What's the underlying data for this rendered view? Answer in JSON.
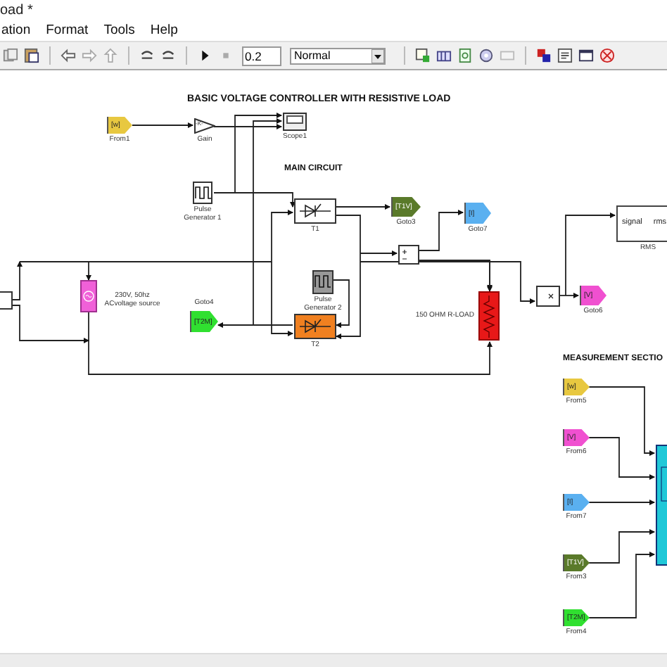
{
  "window": {
    "title": "oad *"
  },
  "menu": [
    "ation",
    "Format",
    "Tools",
    "Help"
  ],
  "toolbar": {
    "stop_time": "0.2",
    "mode": "Normal"
  },
  "diagram": {
    "headings": [
      {
        "kind": "title",
        "text": "BASIC VOLTAGE CONTROLLER WITH RESISTIVE LOAD"
      },
      {
        "kind": "section",
        "text": "MAIN CIRCUIT"
      },
      {
        "kind": "section",
        "text": "MEASUREMENT SECTIO"
      }
    ],
    "blocks": [
      {
        "kind": "tag",
        "text": "[w]",
        "label": "From1",
        "color": "#e8c840"
      },
      {
        "kind": "gain",
        "text": "-K-",
        "label": "Gain"
      },
      {
        "kind": "scope",
        "label": "Scope1"
      },
      {
        "kind": "pulse",
        "label": "Pulse Generator 1"
      },
      {
        "kind": "thyristor",
        "label": "T1",
        "color": "#ffffff"
      },
      {
        "kind": "tag",
        "text": "[T1V]",
        "label": "Goto3",
        "color": "#5a7a2a"
      },
      {
        "kind": "tag",
        "text": "[I]",
        "label": "Goto7",
        "color": "#5ab0f0"
      },
      {
        "kind": "rms",
        "text": "signal",
        "text_2": "rms",
        "label": "RMS"
      },
      {
        "kind": "sum"
      },
      {
        "kind": "terminal"
      },
      {
        "kind": "source",
        "label": "230V, 50hz ACvoltage source"
      },
      {
        "kind": "tag",
        "text": "[T2M]",
        "label": "Goto4",
        "color": "#30e030"
      },
      {
        "kind": "pulse",
        "label": "Pulse Generator 2"
      },
      {
        "kind": "thyristor",
        "label": "T2",
        "color": "#f08020"
      },
      {
        "kind": "resistor",
        "label": "150 OHM R-LOAD"
      },
      {
        "kind": "product"
      },
      {
        "kind": "tag",
        "text": "[V]",
        "label": "Goto6",
        "color": "#f050d0"
      },
      {
        "kind": "tag",
        "text": "[w]",
        "label": "From5",
        "color": "#e8c840"
      },
      {
        "kind": "tag",
        "text": "[V]",
        "label": "From6",
        "color": "#f050d0"
      },
      {
        "kind": "tag",
        "text": "[I]",
        "label": "From7",
        "color": "#5ab0f0"
      },
      {
        "kind": "tag",
        "text": "[T1V]",
        "label": "From3",
        "color": "#5a7a2a"
      },
      {
        "kind": "tag",
        "text": "[T2M]",
        "label": "From4",
        "color": "#30e030"
      },
      {
        "kind": "display"
      }
    ]
  }
}
